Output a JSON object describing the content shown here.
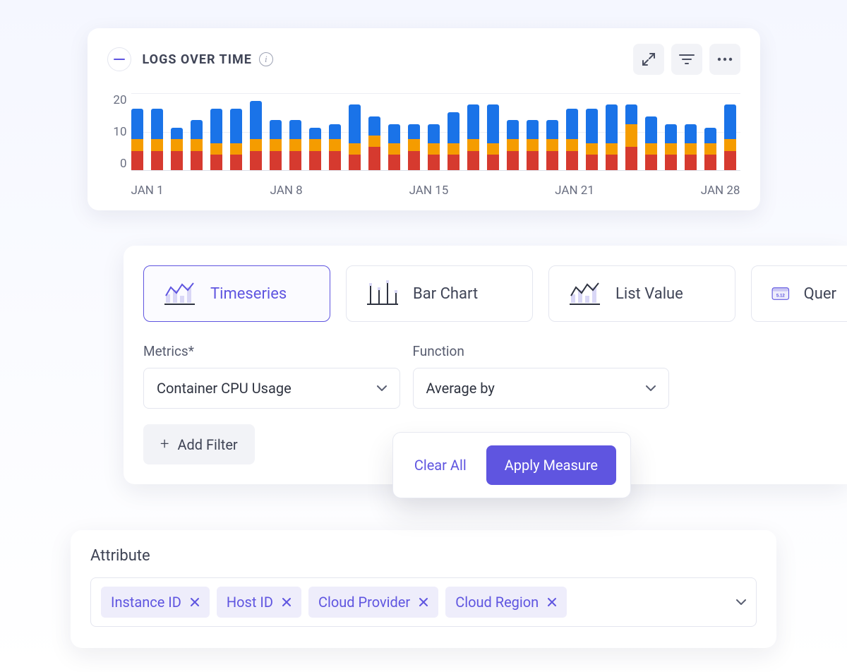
{
  "card1": {
    "title": "LOGS OVER TIME",
    "y_ticks": [
      "20",
      "10",
      "0"
    ],
    "x_ticks": [
      "JAN 1",
      "JAN 8",
      "JAN 15",
      "JAN 21",
      "JAN 28"
    ]
  },
  "chart_data": {
    "type": "bar",
    "stacked": true,
    "title": "Logs Over Time",
    "xlabel": "",
    "ylabel": "",
    "ylim": [
      0,
      20
    ],
    "categories": [
      "Jan 1",
      "Jan 2",
      "Jan 3",
      "Jan 4",
      "Jan 5",
      "Jan 6",
      "Jan 7",
      "Jan 8",
      "Jan 9",
      "Jan 10",
      "Jan 11",
      "Jan 12",
      "Jan 13",
      "Jan 14",
      "Jan 15",
      "Jan 16",
      "Jan 17",
      "Jan 18",
      "Jan 19",
      "Jan 20",
      "Jan 21",
      "Jan 22",
      "Jan 23",
      "Jan 24",
      "Jan 25",
      "Jan 26",
      "Jan 27",
      "Jan 28",
      "Jan 29",
      "Jan 30",
      "Jan 31"
    ],
    "series": [
      {
        "name": "red",
        "color": "#d63a2f",
        "values": [
          5,
          5,
          5,
          5,
          4,
          4,
          5,
          5,
          5,
          5,
          5,
          4,
          6,
          4,
          5,
          4,
          4,
          5,
          4,
          5,
          5,
          5,
          5,
          4,
          4,
          6,
          4,
          4,
          4,
          4,
          5
        ]
      },
      {
        "name": "orange",
        "color": "#f59c00",
        "values": [
          3,
          3,
          3,
          3,
          3,
          3,
          3,
          3,
          3,
          3,
          3,
          3,
          3,
          3,
          3,
          3,
          3,
          3,
          3,
          3,
          3,
          3,
          3,
          3,
          3,
          6,
          3,
          3,
          3,
          3,
          3
        ]
      },
      {
        "name": "blue",
        "color": "#1a73e8",
        "values": [
          8,
          8,
          3,
          5,
          9,
          9,
          10,
          5,
          5,
          3,
          4,
          10,
          5,
          5,
          4,
          5,
          8,
          9,
          10,
          5,
          5,
          5,
          8,
          9,
          10,
          5,
          7,
          5,
          5,
          4,
          9
        ]
      }
    ]
  },
  "card2": {
    "types": [
      {
        "label": "Timeseries",
        "active": true
      },
      {
        "label": "Bar Chart",
        "active": false
      },
      {
        "label": "List Value",
        "active": false
      },
      {
        "label": "Quer",
        "active": false
      }
    ],
    "metrics_label": "Metrics*",
    "function_label": "Function",
    "metrics_value": "Container CPU Usage",
    "function_value": "Average by",
    "add_filter_label": "Add Filter",
    "clear_label": "Clear All",
    "apply_label": "Apply Measure",
    "query_icon_text": "5.12"
  },
  "card3": {
    "title": "Attribute",
    "chips": [
      "Instance ID",
      "Host ID",
      "Cloud Provider",
      "Cloud Region"
    ]
  }
}
